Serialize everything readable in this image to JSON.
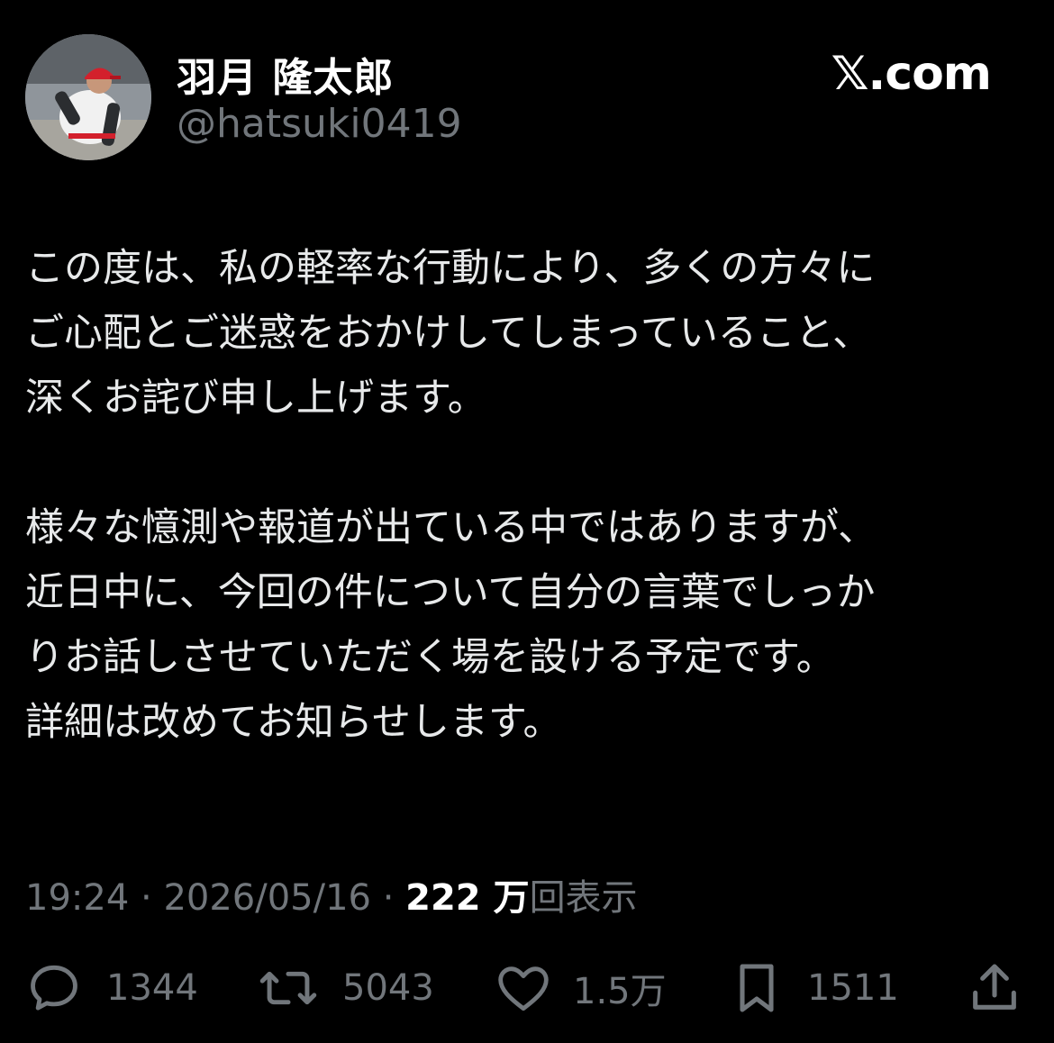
{
  "author": {
    "display_name": "羽月 隆太郎",
    "handle": "@hatsuki0419"
  },
  "brand": "𝕏.com",
  "tweet": {
    "paragraphs": [
      {
        "lines": [
          "この度は、私の軽率な行動により、多くの方々に",
          "ご心配とご迷惑をおかけしてしまっていること、",
          "深くお詫び申し上げます。"
        ]
      },
      {
        "lines": [
          "様々な憶測や報道が出ている中ではありますが、",
          "近日中に、今回の件について自分の言葉でしっか",
          "りお話しさせていただく場を設ける予定です。",
          "詳細は改めてお知らせします。"
        ]
      }
    ]
  },
  "meta": {
    "time": "19:24",
    "separator": " · ",
    "date": "2026/05/16",
    "views_count": "222 万",
    "views_label": "回表示"
  },
  "actions": {
    "replies": "1344",
    "reposts": "5043",
    "likes": "1.5万",
    "bookmarks": "1511"
  },
  "colors": {
    "background": "#000000",
    "text": "#e7e9ea",
    "muted": "#71767b",
    "cap_red": "#d3202c"
  },
  "icons": [
    "reply-icon",
    "repost-icon",
    "like-icon",
    "bookmark-icon",
    "share-icon"
  ]
}
